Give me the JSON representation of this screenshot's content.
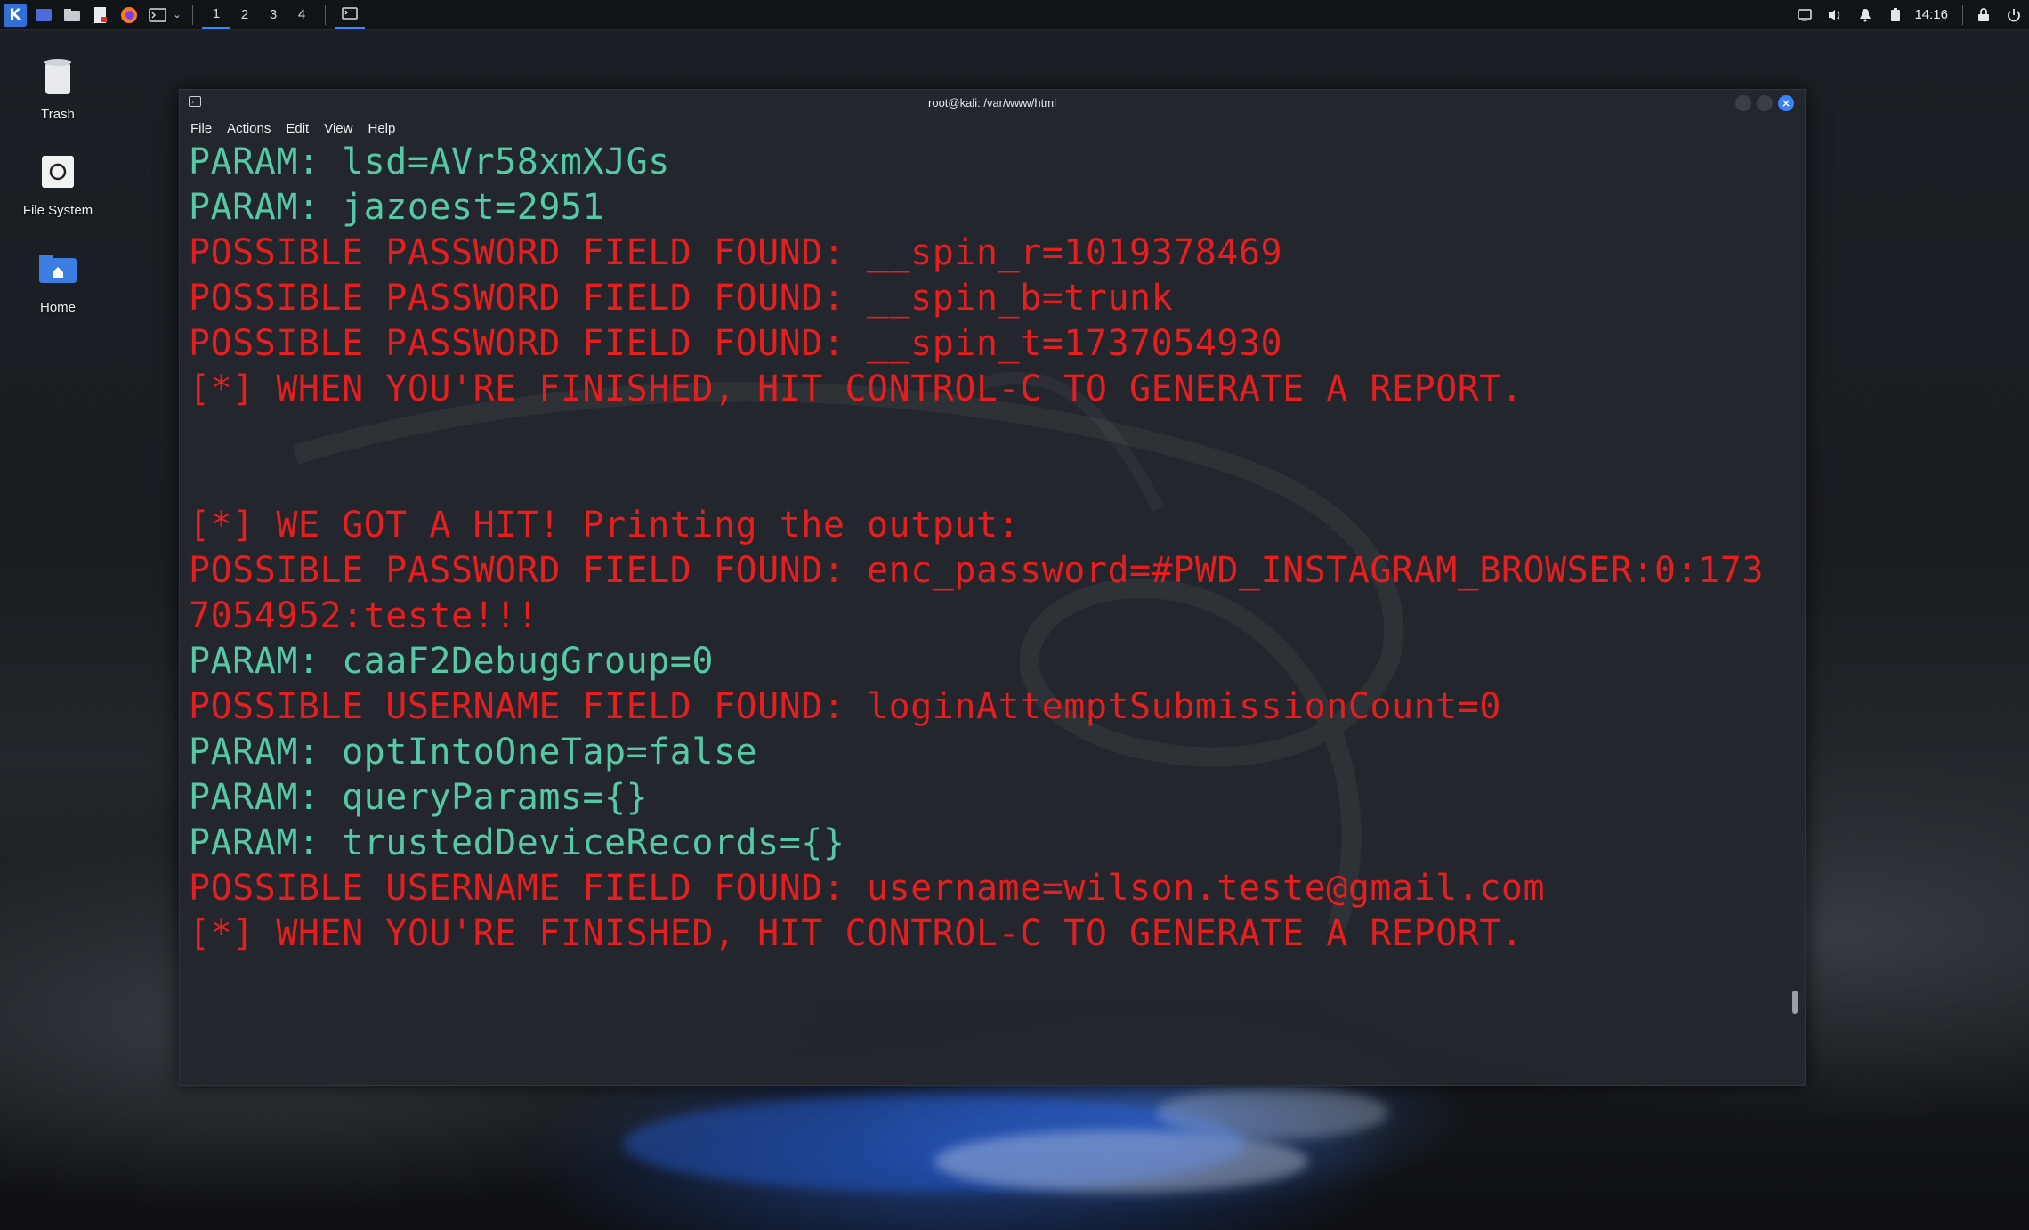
{
  "panel": {
    "workspaces": [
      "1",
      "2",
      "3",
      "4"
    ],
    "active_workspace": "1",
    "clock": "14:16",
    "icons": [
      "kali-menu-icon",
      "desktop-icon",
      "file-manager-icon",
      "text-editor-icon",
      "firefox-icon",
      "terminal-icon",
      "chevron-down-icon",
      "terminal-task-icon",
      "display-icon",
      "volume-icon",
      "bell-icon",
      "battery-icon",
      "lock-icon",
      "power-icon"
    ]
  },
  "desktop": {
    "icons": [
      {
        "label": "Trash",
        "icon": "trash-icon"
      },
      {
        "label": "File System",
        "icon": "drive-icon"
      },
      {
        "label": "Home",
        "icon": "home-folder-icon"
      }
    ]
  },
  "terminal": {
    "title": "root@kali: /var/www/html",
    "menu": [
      "File",
      "Actions",
      "Edit",
      "View",
      "Help"
    ],
    "lines": [
      {
        "text": "PARAM: lsd=AVr58xmXJGs",
        "color": "green"
      },
      {
        "text": "PARAM: jazoest=2951",
        "color": "green"
      },
      {
        "text": "POSSIBLE PASSWORD FIELD FOUND: __spin_r=1019378469",
        "color": "red"
      },
      {
        "text": "POSSIBLE PASSWORD FIELD FOUND: __spin_b=trunk",
        "color": "red"
      },
      {
        "text": "POSSIBLE PASSWORD FIELD FOUND: __spin_t=1737054930",
        "color": "red"
      },
      {
        "text": "[*] WHEN YOU'RE FINISHED, HIT CONTROL-C TO GENERATE A REPORT.",
        "color": "red"
      },
      {
        "text": "",
        "color": "red"
      },
      {
        "text": "",
        "color": "red"
      },
      {
        "text": "[*] WE GOT A HIT! Printing the output:",
        "color": "red"
      },
      {
        "text": "POSSIBLE PASSWORD FIELD FOUND: enc_password=#PWD_INSTAGRAM_BROWSER:0:173",
        "color": "red"
      },
      {
        "text": "7054952:teste!!!",
        "color": "red"
      },
      {
        "text": "PARAM: caaF2DebugGroup=0",
        "color": "green"
      },
      {
        "text": "POSSIBLE USERNAME FIELD FOUND: loginAttemptSubmissionCount=0",
        "color": "red"
      },
      {
        "text": "PARAM: optIntoOneTap=false",
        "color": "green"
      },
      {
        "text": "PARAM: queryParams={}",
        "color": "green"
      },
      {
        "text": "PARAM: trustedDeviceRecords={}",
        "color": "green"
      },
      {
        "text": "POSSIBLE USERNAME FIELD FOUND: username=wilson.teste@gmail.com",
        "color": "red"
      },
      {
        "text": "[*] WHEN YOU'RE FINISHED, HIT CONTROL-C TO GENERATE A REPORT.",
        "color": "red"
      }
    ],
    "colors": {
      "green": "#55c9a6",
      "red": "#e31f1f",
      "background": "#23262d"
    }
  }
}
